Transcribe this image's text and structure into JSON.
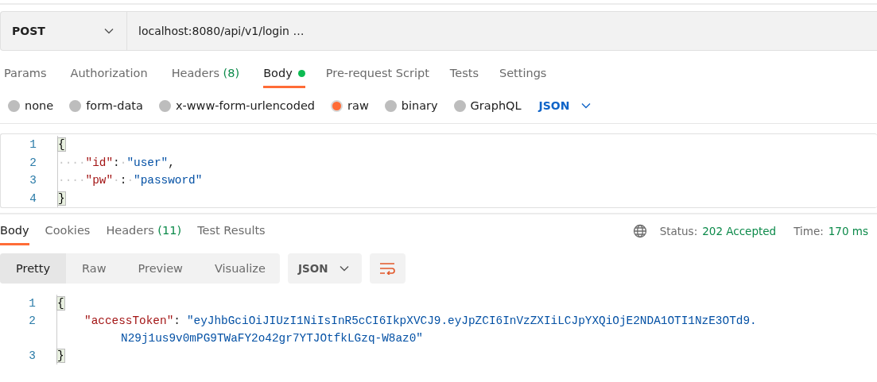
{
  "request": {
    "method": "POST",
    "url": "localhost:8080/api/v1/login …"
  },
  "request_tabs": [
    {
      "label": "Params",
      "selected": false,
      "dot": false
    },
    {
      "label": "Authorization",
      "selected": false,
      "dot": false
    },
    {
      "label": "Headers",
      "count": "(8)",
      "selected": false,
      "dot": false
    },
    {
      "label": "Body",
      "selected": true,
      "dot": true
    },
    {
      "label": "Pre-request Script",
      "selected": false,
      "dot": false
    },
    {
      "label": "Tests",
      "selected": false,
      "dot": false
    },
    {
      "label": "Settings",
      "selected": false,
      "dot": false
    }
  ],
  "body_types": [
    {
      "label": "none",
      "selected": false
    },
    {
      "label": "form-data",
      "selected": false
    },
    {
      "label": "x-www-form-urlencoded",
      "selected": false
    },
    {
      "label": "raw",
      "selected": true
    },
    {
      "label": "binary",
      "selected": false
    },
    {
      "label": "GraphQL",
      "selected": false
    }
  ],
  "body_format": "JSON",
  "request_body": [
    {
      "number": "1",
      "tokens": [
        {
          "kind": "brace",
          "text": "{"
        }
      ]
    },
    {
      "number": "2",
      "tokens": [
        {
          "kind": "ws",
          "text": "····"
        },
        {
          "kind": "key",
          "text": "\"id\""
        },
        {
          "kind": "punct",
          "text": ":"
        },
        {
          "kind": "ws",
          "text": "·"
        },
        {
          "kind": "string",
          "text": "\"user\""
        },
        {
          "kind": "punct",
          "text": ","
        }
      ]
    },
    {
      "number": "3",
      "tokens": [
        {
          "kind": "ws",
          "text": "····"
        },
        {
          "kind": "key",
          "text": "\"pw\""
        },
        {
          "kind": "ws",
          "text": "·"
        },
        {
          "kind": "punct",
          "text": ":"
        },
        {
          "kind": "ws",
          "text": "·"
        },
        {
          "kind": "string",
          "text": "\"password\""
        }
      ]
    },
    {
      "number": "4",
      "tokens": [
        {
          "kind": "brace",
          "text": "}"
        }
      ]
    }
  ],
  "response_tabs": [
    {
      "label": "Body",
      "selected": true
    },
    {
      "label": "Cookies",
      "selected": false
    },
    {
      "label": "Headers",
      "count": "(11)",
      "selected": false
    },
    {
      "label": "Test Results",
      "selected": false
    }
  ],
  "status": {
    "label": "Status:",
    "value": "202 Accepted",
    "time_label": "Time:",
    "time": "170 ms"
  },
  "view_modes": [
    {
      "label": "Pretty",
      "selected": true
    },
    {
      "label": "Raw",
      "selected": false
    },
    {
      "label": "Preview",
      "selected": false
    },
    {
      "label": "Visualize",
      "selected": false
    }
  ],
  "response_format": "JSON",
  "response_body": [
    {
      "number": "1",
      "tokens": [
        {
          "kind": "brace",
          "text": "{"
        }
      ]
    },
    {
      "number": "2",
      "tokens": [
        {
          "kind": "indent"
        },
        {
          "kind": "key",
          "text": "\"accessToken\""
        },
        {
          "kind": "punct",
          "text": ":"
        },
        {
          "kind": "string",
          "text": "\"eyJhbGciOiJIUzI1NiIsInR5cCI6IkpXVCJ9.eyJpZCI6InVzZXIiLCJpYXQiOjE2NDA1OTI1NzE3OTd9."
        }
      ]
    },
    {
      "tokens": [
        {
          "kind": "wrap"
        },
        {
          "kind": "string",
          "text": "N29j1us9v0mPG9TWaFY2o42gr7YTJOtfkLGzq-W8az0\""
        }
      ]
    },
    {
      "number": "3",
      "tokens": [
        {
          "kind": "brace",
          "text": "}"
        }
      ]
    }
  ]
}
